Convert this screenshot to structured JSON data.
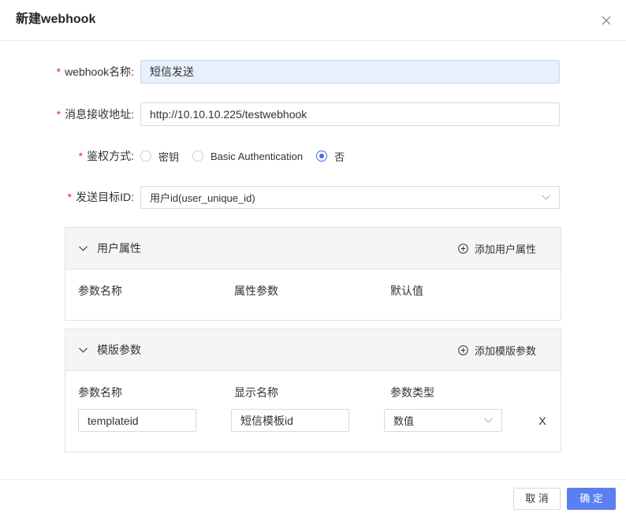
{
  "modal": {
    "title": "新建webhook",
    "close_icon": "close-icon"
  },
  "form": {
    "required_mark": "*",
    "name": {
      "label": "webhook名称:",
      "value": "短信发送"
    },
    "url": {
      "label": "消息接收地址:",
      "value": "http://10.10.10.225/testwebhook"
    },
    "auth": {
      "label": "鉴权方式:",
      "options": [
        {
          "label": "密钥",
          "checked": false
        },
        {
          "label": "Basic Authentication",
          "checked": false
        },
        {
          "label": "否",
          "checked": true
        }
      ]
    },
    "target": {
      "label": "发送目标ID:",
      "value": "用户id(user_unique_id)",
      "icon": "chevron-down-icon"
    }
  },
  "user_attrs": {
    "title": "用户属性",
    "add_label": "添加用户属性",
    "columns": [
      "参数名称",
      "属性参数",
      "默认值"
    ]
  },
  "template_params": {
    "title": "模版参数",
    "add_label": "添加模版参数",
    "columns": [
      "参数名称",
      "显示名称",
      "参数类型"
    ],
    "rows": [
      {
        "name": "templateid",
        "display": "短信模板id",
        "type": "数值",
        "remove": "X"
      }
    ]
  },
  "footer": {
    "cancel": "取 消",
    "confirm": "确 定"
  },
  "colors": {
    "primary": "#5b7ff0",
    "required": "#f5222d",
    "autofill_bg": "#e8f0fe",
    "radio_checked": "#3b6cf0"
  }
}
